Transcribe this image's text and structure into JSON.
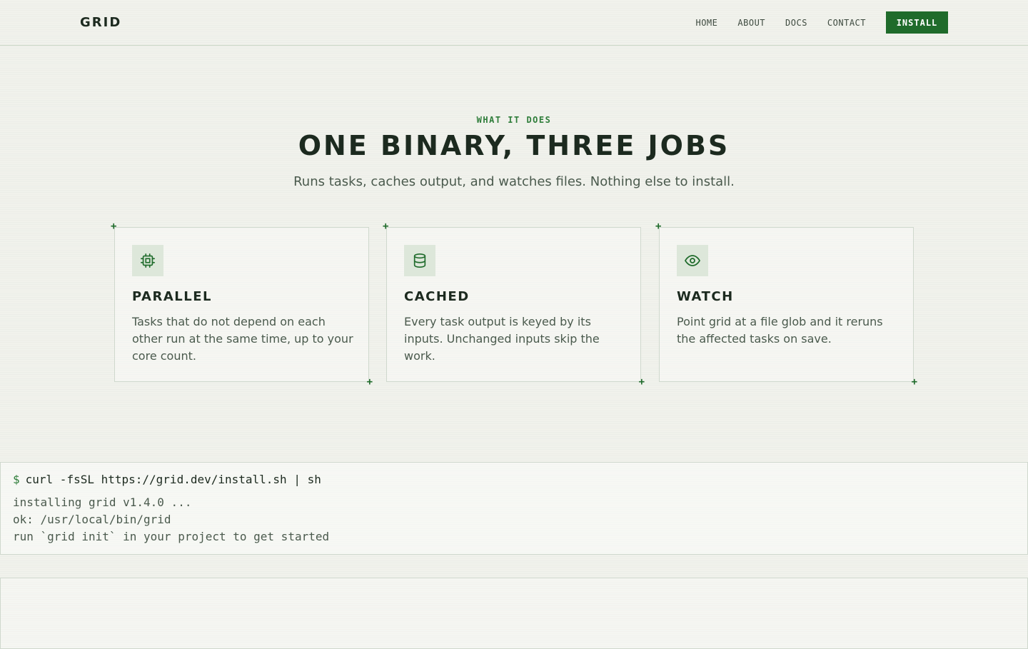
{
  "nav": {
    "logo": "GRID",
    "links": [
      "HOME",
      "ABOUT",
      "DOCS",
      "CONTACT"
    ],
    "install_label": "INSTALL"
  },
  "hero": {
    "eyebrow": "WHAT IT DOES",
    "headline": "ONE BINARY, THREE JOBS",
    "subline": "Runs tasks, caches output, and watches files. Nothing else to install."
  },
  "features": [
    {
      "icon": "chip-icon",
      "title": "PARALLEL",
      "text": "Tasks that do not depend on each other run at the same time, up to your core count."
    },
    {
      "icon": "database-icon",
      "title": "CACHED",
      "text": "Every task output is keyed by its inputs. Unchanged inputs skip the work."
    },
    {
      "icon": "eye-icon",
      "title": "WATCH",
      "text": "Point grid at a file glob and it reruns the affected tasks on save."
    }
  ],
  "corner_marker": "+",
  "terminal": {
    "prompt": "$",
    "command": "curl -fsSL https://grid.dev/install.sh | sh",
    "output": [
      "installing grid v1.4.0 ...",
      "ok: /usr/local/bin/grid",
      "run `grid init` in your project to get started"
    ]
  },
  "colors": {
    "accent": "#1f6b2b",
    "eyebrow": "#2e7d3a",
    "background": "#f1f2ec",
    "icon_bg": "#dde7da"
  }
}
